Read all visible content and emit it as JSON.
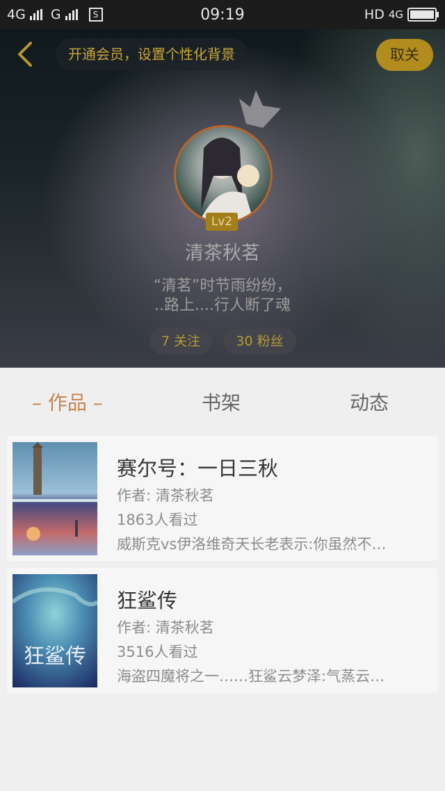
{
  "status_bar": {
    "left_text_1": "4G",
    "left_text_2": "G",
    "sim_icon": "S",
    "time": "09:19",
    "right_text": "HD",
    "network": "4G"
  },
  "header": {
    "promo_text": "开通会员，设置个性化背景",
    "unfollow_label": "取关"
  },
  "profile": {
    "level": "Lv2",
    "name": "清茶秋茗",
    "bio_line1": "“清茗”时节雨纷纷，",
    "bio_line2": "..路上....行人断了魂",
    "following": "7 关注",
    "followers": "30 粉丝"
  },
  "tabs": {
    "works": "– 作品 –",
    "bookshelf": "书架",
    "activity": "动态"
  },
  "books": [
    {
      "title": "赛尔号：一日三秋",
      "author": "作者: 清茶秋茗",
      "views": "1863人看过",
      "desc": "威斯克vs伊洛维奇天长老表示:你虽然不…"
    },
    {
      "title": "狂鲨传",
      "author": "作者: 清茶秋茗",
      "views": "3516人看过",
      "desc": "海盗四魔将之一……狂鲨云梦泽:气蒸云…",
      "cover_text": "狂鲨传"
    }
  ],
  "colors": {
    "accent": "#c7844f",
    "gold": "#b28d1e"
  }
}
